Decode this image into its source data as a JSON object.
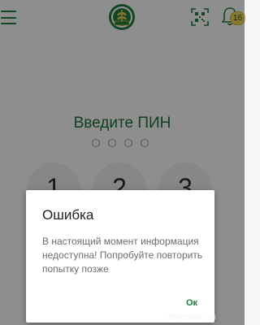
{
  "pin_screen": {
    "title": "Введите ПИН",
    "dots_filled": 0,
    "dots_total": 4,
    "keys": [
      "1",
      "2",
      "3"
    ]
  },
  "header": {
    "menu_icon": "hamburger-menu-icon",
    "logo_icon": "bank-logo-icon",
    "qr_icon": "qr-code-scan-icon",
    "bell_icon": "bell-icon",
    "notification_count": "16"
  },
  "dialog": {
    "title": "Ошибка",
    "message": "В настоящий момент информация недоступна! Попробуйте повторить попытку позже",
    "ok_label": "Ок"
  },
  "watermark": "mynswer.ru",
  "colors": {
    "brand_green": "#1f7a3a",
    "badge_yellow": "#e9d45a",
    "background": "#f5f5f5",
    "key_background": "#e9e9e9"
  }
}
